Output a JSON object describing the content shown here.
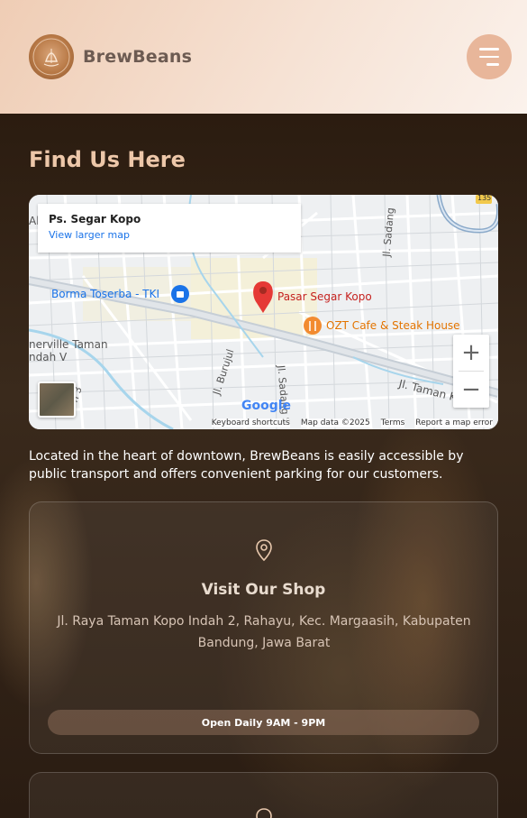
{
  "header": {
    "brand_name": "BrewBeans",
    "logo_icon": "coffee-logo-icon",
    "menu_icon": "hamburger-menu-icon"
  },
  "section": {
    "title": "Find Us Here",
    "description": "Located in the heart of downtown, BrewBeans is easily accessible by public transport and offers convenient parking for our customers."
  },
  "map": {
    "place_name": "Ps. Segar Kopo",
    "view_larger": "View larger map",
    "labels": {
      "borma": "Borma Toserba - TKI",
      "pasar": "Pasar Segar Kopo",
      "ozt": "OZT Cafe & Steak House",
      "herville": "nerville Taman",
      "indah": "ndah V",
      "burujul": "Jl. Burujul",
      "sadang": "Jl. Sadang",
      "sadang2": "Jl. Sadang S",
      "taman": "Jl. Taman K",
      "ai": "Al",
      "route": "135",
      "n3": "n 3"
    },
    "footer": {
      "shortcuts": "Keyboard shortcuts",
      "mapdata": "Map data ©2025",
      "terms": "Terms",
      "report": "Report a map error"
    },
    "google": "Google",
    "zoom_in": "+",
    "zoom_out": "−"
  },
  "shop_card": {
    "title": "Visit Our Shop",
    "address": "Jl. Raya Taman Kopo Indah 2, Rahayu, Kec. Margaasih, Kabupaten Bandung, Jawa Barat",
    "hours": "Open Daily 9AM - 9PM",
    "icon": "location-pin-icon"
  },
  "colors": {
    "accent": "#edc7a9",
    "header_bg": "#f3d8c6",
    "menu_button": "#e8b69a"
  }
}
